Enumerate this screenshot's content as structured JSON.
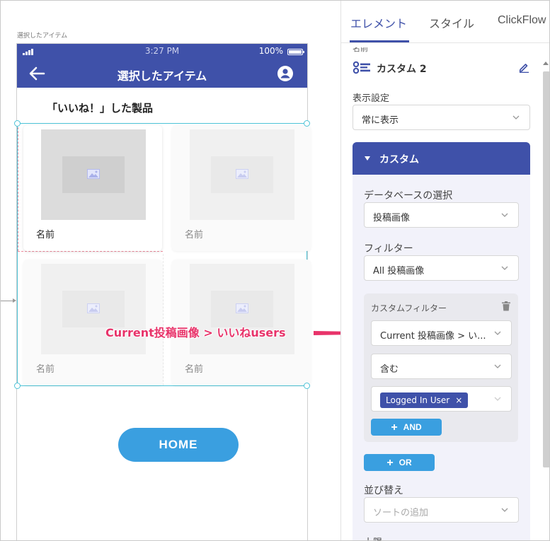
{
  "canvas": {
    "screen_label": "選択したアイテム",
    "status_time": "3:27 PM",
    "battery_text": "100%",
    "app_title": "選択したアイテム",
    "section_title": "「いいね！」した製品",
    "cards": [
      {
        "name": "名前"
      },
      {
        "name": "名前"
      },
      {
        "name": "名前"
      },
      {
        "name": "名前"
      }
    ],
    "home_label": "HOME"
  },
  "annotation": {
    "text": "Current投稿画像 > いいねusers",
    "color": "#e8336a"
  },
  "panel": {
    "tabs": [
      "エレメント",
      "スタイル",
      "ClickFlow"
    ],
    "active_tab": "エレメント",
    "name_cut_label": "名前",
    "element_name": "カスタム 2",
    "visibility_label": "表示設定",
    "visibility_value": "常に表示",
    "custom_section_title": "カスタム",
    "db_label": "データベースの選択",
    "db_value": "投稿画像",
    "filter_label": "フィルター",
    "filter_value": "All 投稿画像",
    "custom_filter_label": "カスタムフィルター",
    "custom_filter_field": "Current 投稿画像 > い...",
    "operator_value": "含む",
    "chip_label": "Logged In User",
    "chip_close": "×",
    "and_label": "AND",
    "or_label": "OR",
    "sort_label": "並び替え",
    "sort_placeholder": "ソートの追加",
    "cut_bottom_label": "上限"
  },
  "colors": {
    "primary": "#3f51a9",
    "button": "#3a9fe0",
    "selection": "#4cc3d7",
    "annotation": "#e8336a"
  },
  "icons": [
    "signal-icon",
    "battery-icon",
    "back-arrow-icon",
    "account-icon",
    "image-placeholder-icon",
    "custom-component-icon",
    "edit-pencil-icon",
    "chevron-down-icon",
    "caret-down-icon",
    "trash-icon",
    "close-icon",
    "plus-icon",
    "arrow-right-icon"
  ]
}
